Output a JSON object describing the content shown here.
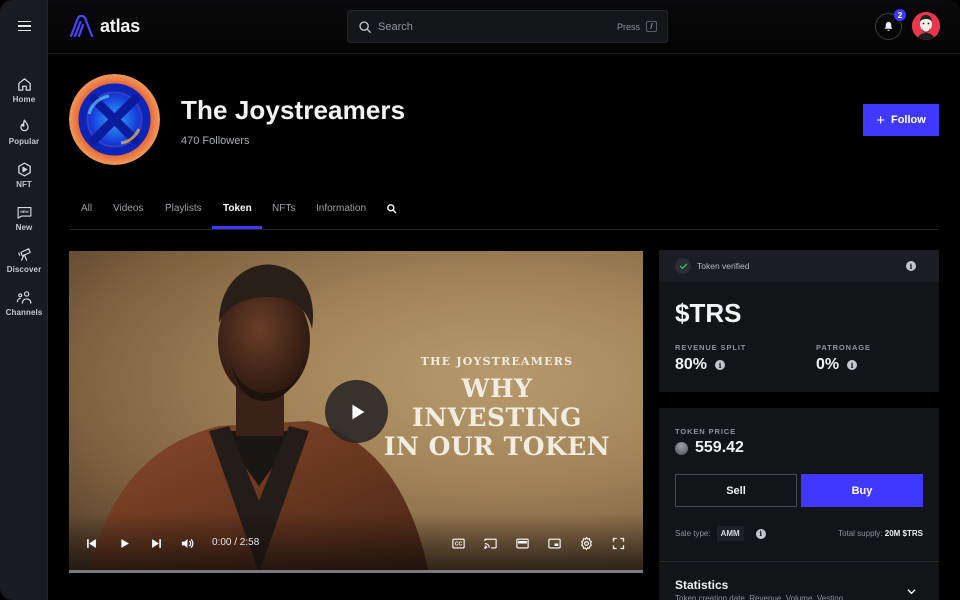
{
  "app": {
    "name": "atlas"
  },
  "sidebar": {
    "items": [
      {
        "label": "Home",
        "icon": "home-icon"
      },
      {
        "label": "Popular",
        "icon": "fire-icon"
      },
      {
        "label": "NFT",
        "icon": "nft-play-icon"
      },
      {
        "label": "New",
        "icon": "new-icon"
      },
      {
        "label": "Discover",
        "icon": "telescope-icon"
      },
      {
        "label": "Channels",
        "icon": "channels-icon"
      }
    ]
  },
  "topbar": {
    "search_placeholder": "Search",
    "press_label": "Press",
    "shortcut_key": "/",
    "notification_count": "2"
  },
  "channel": {
    "title": "The Joystreamers",
    "followers": "470 Followers",
    "follow_label": "Follow"
  },
  "tabs": [
    {
      "label": "All",
      "active": false
    },
    {
      "label": "Videos",
      "active": false
    },
    {
      "label": "Playlists",
      "active": false
    },
    {
      "label": "Token",
      "active": true
    },
    {
      "label": "NFTs",
      "active": false
    },
    {
      "label": "Information",
      "active": false
    }
  ],
  "video": {
    "overlay_small": "THE JOYSTREAMERS",
    "overlay_big_line1": "WHY",
    "overlay_big_line2": "INVESTING",
    "overlay_big_line3": "IN OUR TOKEN",
    "time": "0:00 / 2:58",
    "progress_percent": 0
  },
  "token": {
    "verified_label": "Token verified",
    "ticker": "$TRS",
    "revenue_split_label": "REVENUE SPLIT",
    "revenue_split_value": "80%",
    "patronage_label": "PATRONAGE",
    "patronage_value": "0%",
    "price_label": "TOKEN PRICE",
    "price_value": "559.42",
    "sell_label": "Sell",
    "buy_label": "Buy",
    "sale_type_label": "Sale type:",
    "sale_type_value": "AMM",
    "total_supply_label": "Total supply:",
    "total_supply_value": "20M $TRS",
    "statistics_title": "Statistics",
    "statistics_subtitle": "Token creation date, Revenue, Volume, Vesting"
  },
  "colors": {
    "accent": "#4038ff",
    "background": "#000000",
    "sidebar": "#181b20",
    "panel": "#121418",
    "verified_check": "#2fbf71"
  }
}
